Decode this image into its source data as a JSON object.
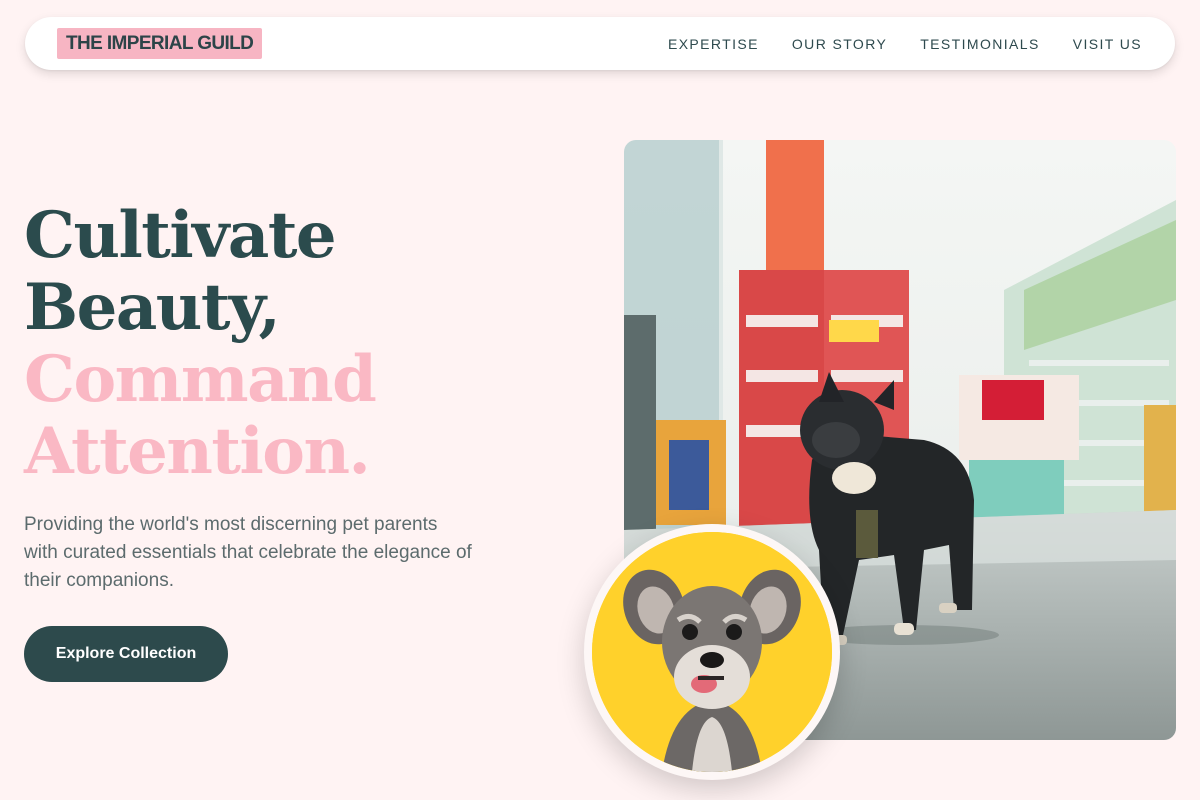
{
  "brand": {
    "logo_text": "THE IMPERIAL GUILD"
  },
  "nav": {
    "items": [
      {
        "label": "EXPERTISE"
      },
      {
        "label": "OUR STORY"
      },
      {
        "label": "TESTIMONIALS"
      },
      {
        "label": "VISIT US"
      }
    ]
  },
  "hero": {
    "title_line1": "Cultivate",
    "title_line2": "Beauty,",
    "title_line3": "Command",
    "title_line4": "Attention.",
    "subtitle": "Providing the world's most discerning pet parents with curated essentials that celebrate the elegance of their companions.",
    "cta_label": "Explore Collection"
  },
  "images": {
    "main": "french-bulldog-in-pet-store-photo",
    "secondary": "schnauzer-puppy-on-yellow-photo"
  },
  "colors": {
    "background": "#fff3f3",
    "accent_pink": "#fab8c4",
    "dark_teal": "#2d4a4c",
    "text_gray": "#5c6b6d"
  }
}
